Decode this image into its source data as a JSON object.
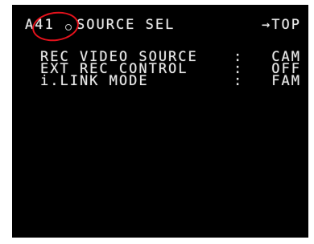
{
  "osd": {
    "page_code": "A41",
    "title": "SOURCE SEL",
    "top_link": "→TOP",
    "rows": [
      {
        "label": "REC VIDEO SOURCE",
        "colon": ":",
        "value": "CAM"
      },
      {
        "label": "EXT REC CONTROL",
        "colon": ":",
        "value": "OFF"
      },
      {
        "label": "i.LINK MODE",
        "colon": ":",
        "value": "FAM"
      }
    ]
  },
  "colors": {
    "background": "#000000",
    "text": "#e8e8e8",
    "annotation": "#e5121c"
  }
}
